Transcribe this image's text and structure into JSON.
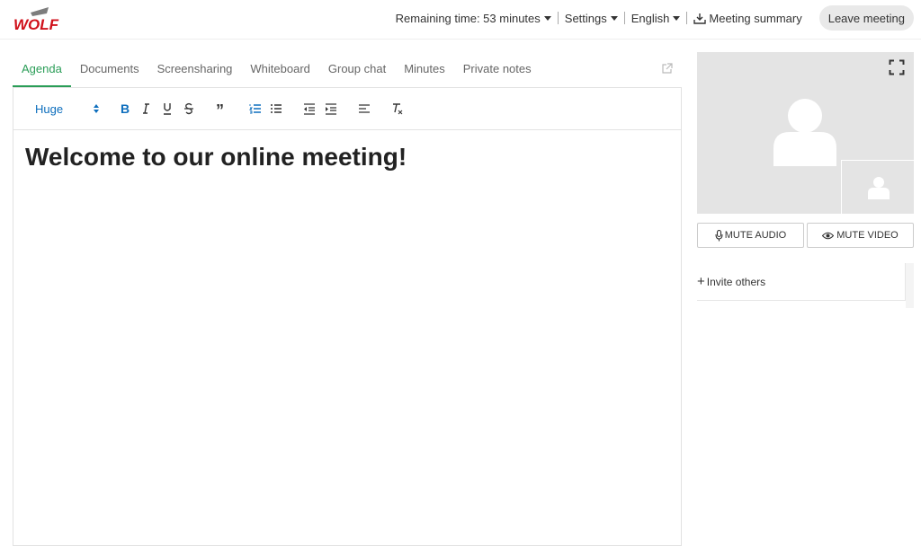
{
  "header": {
    "logo_text": "WOLF",
    "remaining_time": "Remaining time: 53 minutes",
    "settings": "Settings",
    "language": "English",
    "meeting_summary": "Meeting summary",
    "leave_meeting": "Leave meeting"
  },
  "tabs": [
    {
      "label": "Agenda",
      "active": true
    },
    {
      "label": "Documents"
    },
    {
      "label": "Screensharing"
    },
    {
      "label": "Whiteboard"
    },
    {
      "label": "Group chat"
    },
    {
      "label": "Minutes"
    },
    {
      "label": "Private notes"
    }
  ],
  "editor": {
    "size_value": "Huge",
    "heading": "Welcome to our online meeting!"
  },
  "video": {
    "mute_audio": "MUTE AUDIO",
    "mute_video": "MUTE VIDEO"
  },
  "invite": {
    "label": "Invite others"
  },
  "colors": {
    "accent_green": "#2a9d57",
    "brand_red": "#d0111b",
    "toolbar_blue": "#0d6ebd"
  }
}
